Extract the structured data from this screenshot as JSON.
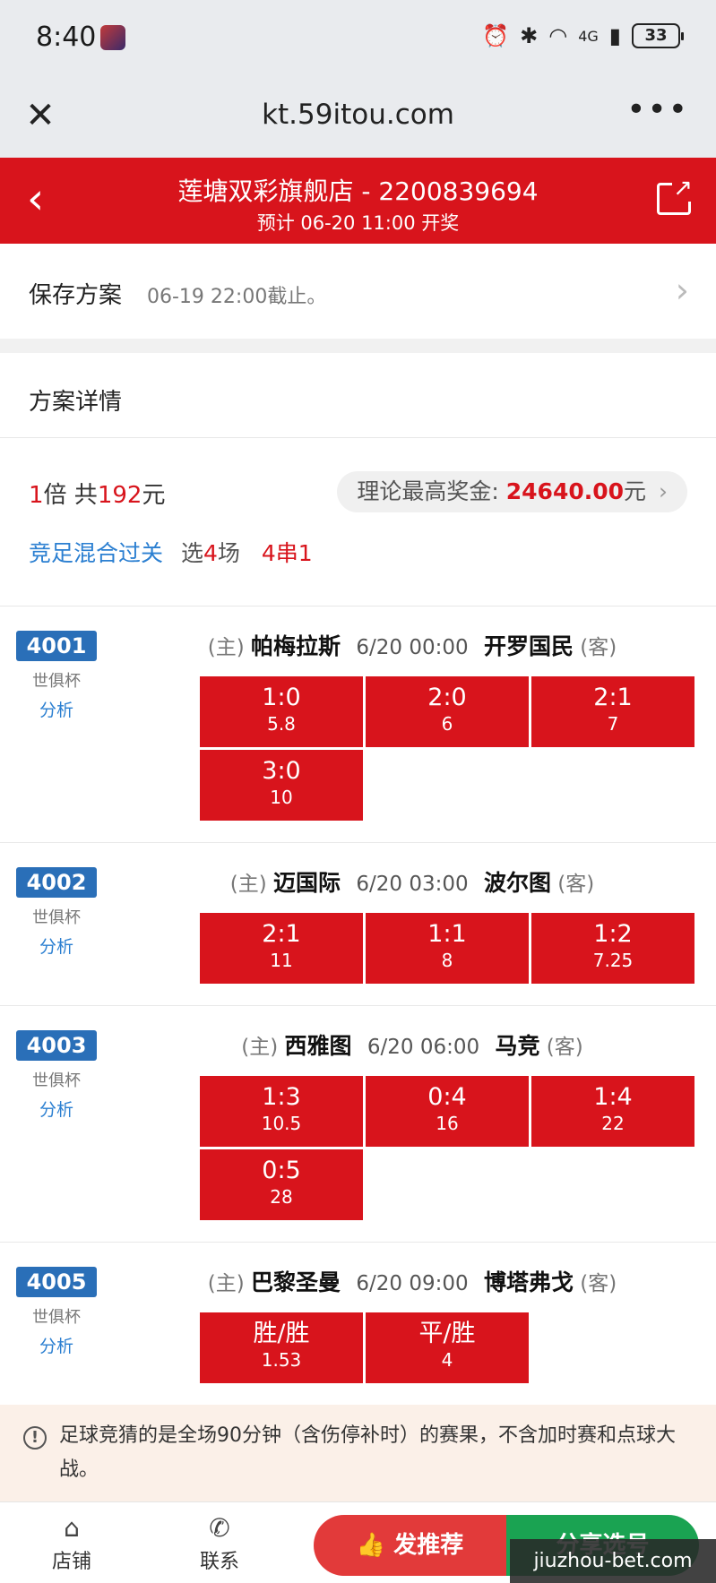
{
  "status": {
    "time": "8:40",
    "network": "4G",
    "battery": "33"
  },
  "browser": {
    "url": "kt.59itou.com"
  },
  "header": {
    "title": "莲塘双彩旗舰店 - 2200839694",
    "subtitle": "预计 06-20 11:00 开奖"
  },
  "save": {
    "label": "保存方案",
    "deadline": "06-19 22:00截止。"
  },
  "detail": {
    "title": "方案详情",
    "multiplier": "1",
    "multiplier_unit": "倍 共",
    "total": "192",
    "total_unit": "元",
    "max_prize_label": "理论最高奖金:",
    "max_prize_value": "24640.00",
    "max_prize_unit": "元",
    "play_type": "竞足混合过关",
    "select_label": "选",
    "select_count": "4",
    "select_unit": "场",
    "combo": "4串1"
  },
  "matches": [
    {
      "id": "4001",
      "league": "世俱杯",
      "analysis": "分析",
      "home": "帕梅拉斯",
      "time": "6/20 00:00",
      "away": "开罗国民",
      "picks": [
        {
          "score": "1:0",
          "odds": "5.8"
        },
        {
          "score": "2:0",
          "odds": "6"
        },
        {
          "score": "2:1",
          "odds": "7"
        },
        {
          "score": "3:0",
          "odds": "10"
        }
      ]
    },
    {
      "id": "4002",
      "league": "世俱杯",
      "analysis": "分析",
      "home": "迈国际",
      "time": "6/20 03:00",
      "away": "波尔图",
      "picks": [
        {
          "score": "2:1",
          "odds": "11"
        },
        {
          "score": "1:1",
          "odds": "8"
        },
        {
          "score": "1:2",
          "odds": "7.25"
        }
      ]
    },
    {
      "id": "4003",
      "league": "世俱杯",
      "analysis": "分析",
      "home": "西雅图",
      "time": "6/20 06:00",
      "away": "马竞",
      "picks": [
        {
          "score": "1:3",
          "odds": "10.5"
        },
        {
          "score": "0:4",
          "odds": "16"
        },
        {
          "score": "1:4",
          "odds": "22"
        },
        {
          "score": "0:5",
          "odds": "28"
        }
      ]
    },
    {
      "id": "4005",
      "league": "世俱杯",
      "analysis": "分析",
      "home": "巴黎圣曼",
      "time": "6/20 09:00",
      "away": "博塔弗戈",
      "picks": [
        {
          "score": "胜/胜",
          "odds": "1.53"
        },
        {
          "score": "平/胜",
          "odds": "4"
        }
      ]
    }
  ],
  "labels": {
    "home_tag": "(主)",
    "away_tag": "(客)"
  },
  "notice": {
    "text": "足球竞猜的是全场90分钟（含伤停补时）的赛果，不含加时赛和点球大战。"
  },
  "bottom": {
    "store": "店铺",
    "contact": "联系",
    "recommend": "发推荐",
    "share": "分享选号"
  },
  "watermark": "jiuzhou-bet.com"
}
